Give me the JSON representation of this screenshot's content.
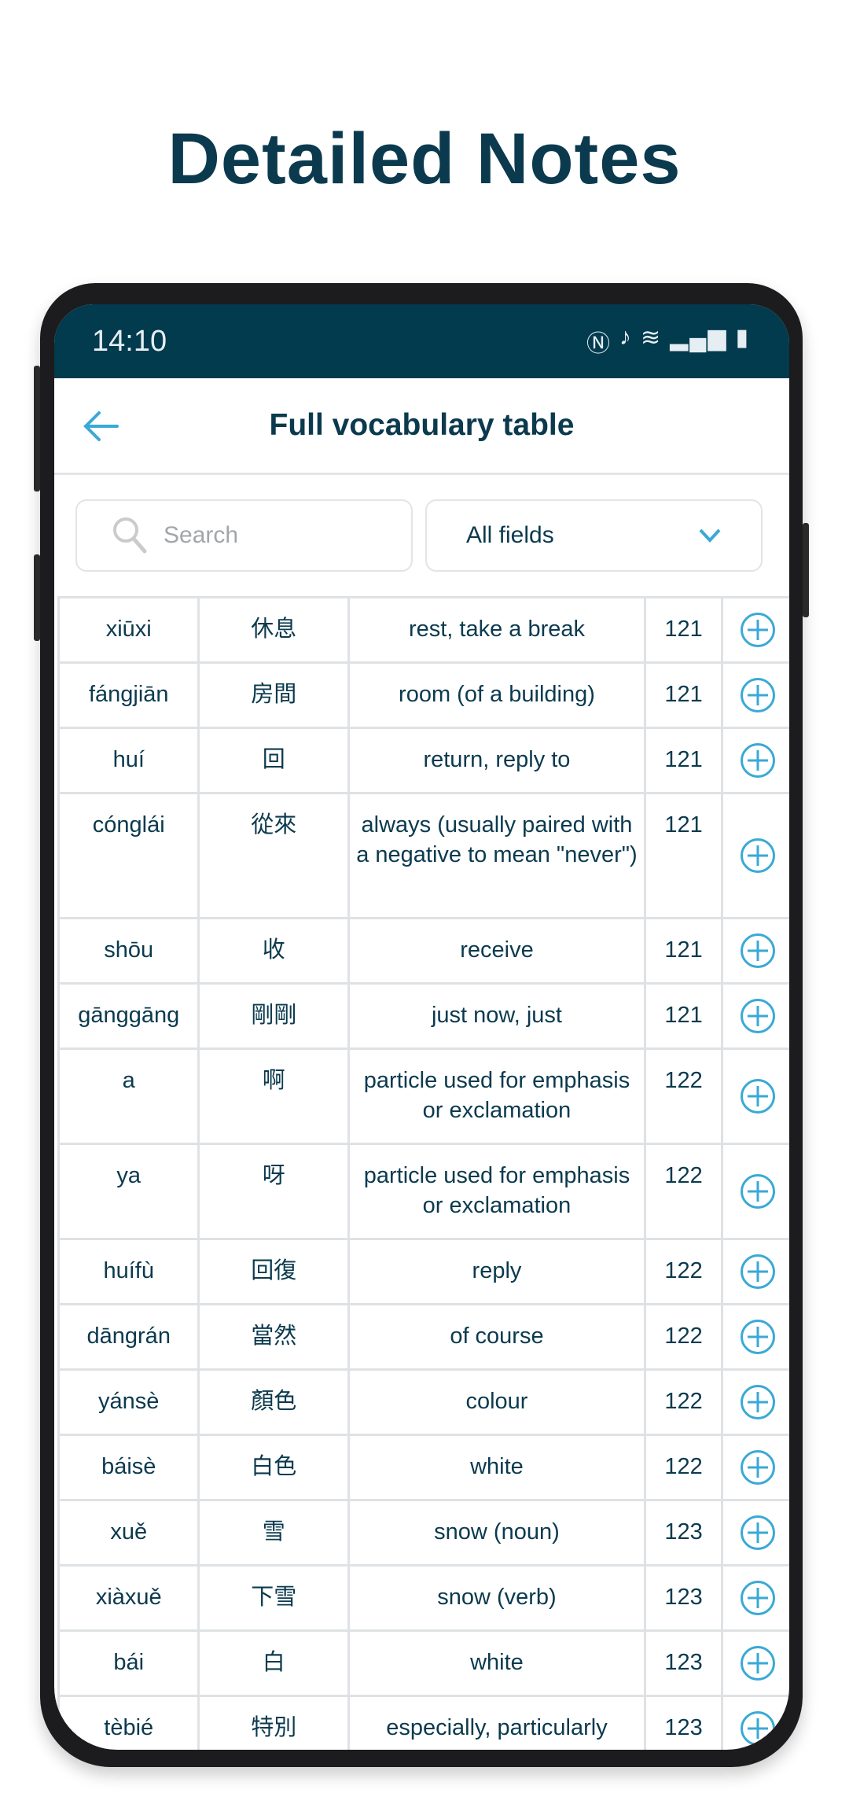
{
  "headline": "Detailed Notes",
  "status_bar": {
    "time": "14:10",
    "icons": [
      "nfc-icon",
      "vibrate-icon",
      "wifi-icon",
      "signal-icon",
      "battery-charging-icon"
    ]
  },
  "app_bar": {
    "title": "Full vocabulary table",
    "back_icon": "arrow-left-icon"
  },
  "filters": {
    "search_placeholder": "Search",
    "field_select": "All fields"
  },
  "colors": {
    "primary": "#023a4e",
    "accent": "#3aa9d6",
    "text": "#0b3a4e"
  },
  "rows": [
    {
      "pinyin": "xiūxi",
      "hanzi": "休息",
      "meaning": "rest, take a break",
      "lesson": "121"
    },
    {
      "pinyin": "fángjiān",
      "hanzi": "房間",
      "meaning": "room (of a building)",
      "lesson": "121"
    },
    {
      "pinyin": "huí",
      "hanzi": "回",
      "meaning": "return, reply to",
      "lesson": "121"
    },
    {
      "pinyin": "cónglái",
      "hanzi": "從來",
      "meaning": "always (usually paired with a negative to mean \"never\")",
      "lesson": "121"
    },
    {
      "pinyin": "shōu",
      "hanzi": "收",
      "meaning": "receive",
      "lesson": "121"
    },
    {
      "pinyin": "gānggāng",
      "hanzi": "剛剛",
      "meaning": "just now, just",
      "lesson": "121"
    },
    {
      "pinyin": "a",
      "hanzi": "啊",
      "meaning": "particle used for emphasis or exclamation",
      "lesson": "122"
    },
    {
      "pinyin": "ya",
      "hanzi": "呀",
      "meaning": "particle used for emphasis or exclamation",
      "lesson": "122"
    },
    {
      "pinyin": "huífù",
      "hanzi": "回復",
      "meaning": "reply",
      "lesson": "122"
    },
    {
      "pinyin": "dāngrán",
      "hanzi": "當然",
      "meaning": "of course",
      "lesson": "122"
    },
    {
      "pinyin": "yánsè",
      "hanzi": "顏色",
      "meaning": "colour",
      "lesson": "122"
    },
    {
      "pinyin": "báisè",
      "hanzi": "白色",
      "meaning": "white",
      "lesson": "122"
    },
    {
      "pinyin": "xuě",
      "hanzi": "雪",
      "meaning": "snow (noun)",
      "lesson": "123"
    },
    {
      "pinyin": "xiàxuě",
      "hanzi": "下雪",
      "meaning": "snow (verb)",
      "lesson": "123"
    },
    {
      "pinyin": "bái",
      "hanzi": "白",
      "meaning": "white",
      "lesson": "123"
    },
    {
      "pinyin": "tèbié",
      "hanzi": "特別",
      "meaning": "especially, particularly",
      "lesson": "123"
    }
  ]
}
